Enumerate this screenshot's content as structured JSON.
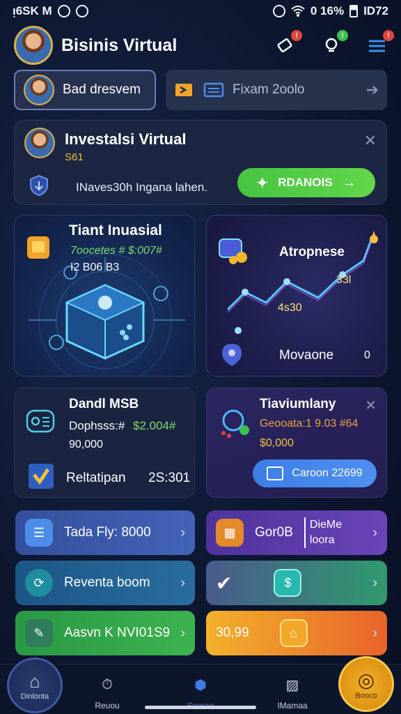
{
  "status_bar": {
    "left": "ᴉ6SK M",
    "right": "0 16%",
    "time": "ID72"
  },
  "header": {
    "title": "Bisinis Virtual"
  },
  "profile_pill": {
    "label": "Bad dresvem"
  },
  "search_pill": {
    "label": "Fixam 2oolo"
  },
  "invest_card": {
    "title": "Investalsi Virtual",
    "subtitle": "S61",
    "description": "INaves30h Ingana lahen.",
    "button_label": "RDANOIS"
  },
  "industrial_tile": {
    "title": "Tiant Inuasial",
    "line1": "7oocetes # $:007#",
    "line2": "I2 B06 B3"
  },
  "trend_tile": {
    "title": "Atropnese",
    "point_a": "33l",
    "point_b": "4s30",
    "footer": "Movaone",
    "footer_count": "0"
  },
  "dandl_tile": {
    "title": "Dandl MSB",
    "line1": "Dophsss:#",
    "amount": "$2.004#",
    "line2": "90,000",
    "footer_label": "Reltatipan",
    "footer_value": "2S:301"
  },
  "tiavium_tile": {
    "title": "Tiaviumlany",
    "line1": "Geooata:1 9.03 #64",
    "line2": "$0,000",
    "button_label": "Caroon 22699"
  },
  "rows_left": [
    {
      "label": "Tada Fly: 8000",
      "color": "#3f5cb0",
      "icon_color": "#4c8de8"
    },
    {
      "label": "Reventa boom",
      "color": "#23628e",
      "icon_color": "#2fa6b8"
    },
    {
      "label": "Aasvn K NVI01S9",
      "color": "#2fa348",
      "icon_color": "#2f8f5a"
    }
  ],
  "rows_right": [
    {
      "label": "Gor0B",
      "extra1": "DieMe",
      "extra2": "loora",
      "color": "#5b3aa5"
    },
    {
      "label": "",
      "color": "#3b8a78"
    },
    {
      "label": "30,99",
      "color": "#e28a22"
    }
  ],
  "bottom_nav": {
    "home": "Dinlonta",
    "item2": "Reuou",
    "item3": "Seoraa",
    "item4": "IMamaa",
    "fab": "Booco"
  }
}
